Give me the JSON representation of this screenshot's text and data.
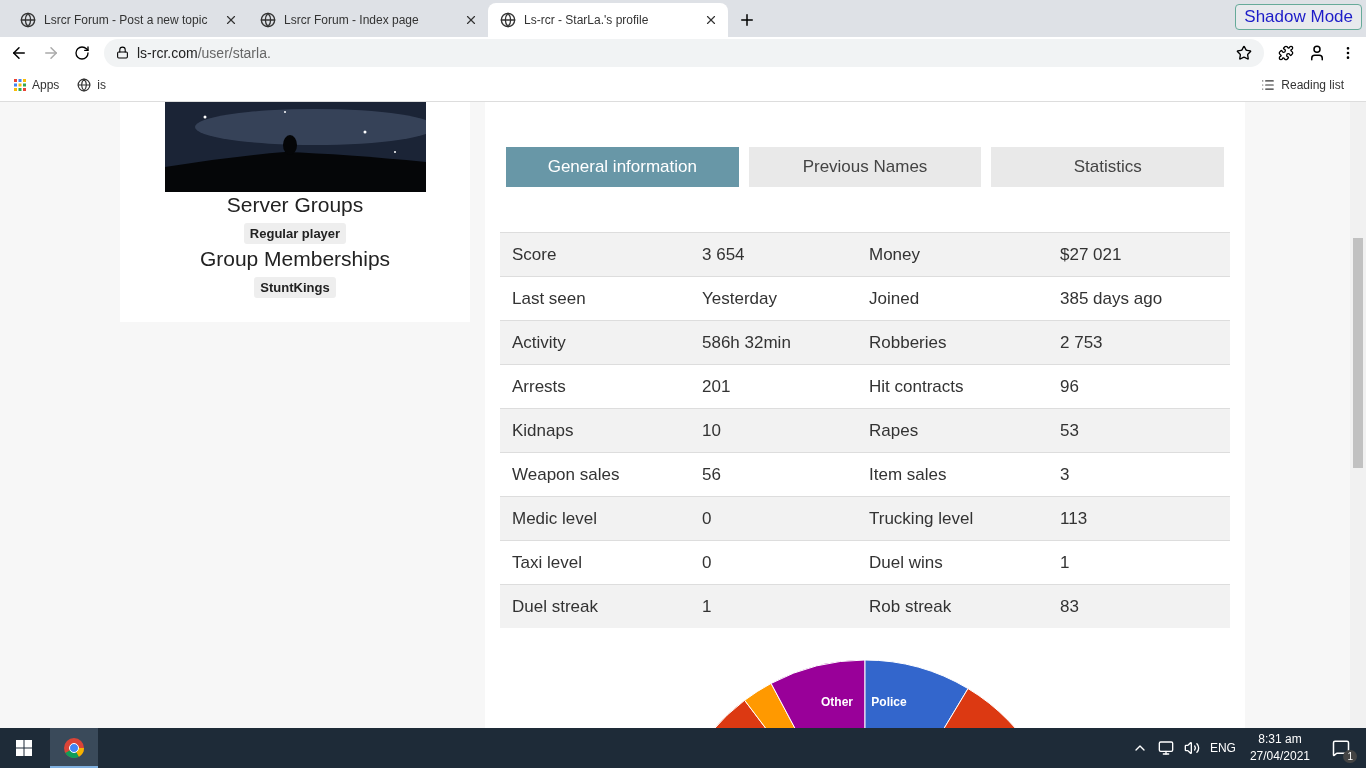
{
  "browser": {
    "tabs": [
      {
        "title": "Lsrcr Forum - Post a new topic",
        "selected": false
      },
      {
        "title": "Lsrcr Forum - Index page",
        "selected": false
      },
      {
        "title": "Ls-rcr - StarLa.'s profile",
        "selected": true
      }
    ],
    "extension_button": "Shadow Mode",
    "url_host": "ls-rcr.com",
    "url_path": "/user/starla.",
    "bookmarks": [
      "Apps",
      "is"
    ],
    "reading_list": "Reading list"
  },
  "profile": {
    "server_groups_title": "Server Groups",
    "server_groups": [
      "Regular player"
    ],
    "memberships_title": "Group Memberships",
    "memberships": [
      "StuntKings"
    ]
  },
  "tabs": [
    {
      "label": "General information",
      "selected": true
    },
    {
      "label": "Previous Names",
      "selected": false
    },
    {
      "label": "Statistics",
      "selected": false
    }
  ],
  "stats": [
    [
      "Score",
      "3 654",
      "Money",
      "$27 021"
    ],
    [
      "Last seen",
      "Yesterday",
      "Joined",
      "385 days ago"
    ],
    [
      "Activity",
      "586h 32min",
      "Robberies",
      "2 753"
    ],
    [
      "Arrests",
      "201",
      "Hit contracts",
      "96"
    ],
    [
      "Kidnaps",
      "10",
      "Rapes",
      "53"
    ],
    [
      "Weapon sales",
      "56",
      "Item sales",
      "3"
    ],
    [
      "Medic level",
      "0",
      "Trucking level",
      "113"
    ],
    [
      "Taxi level",
      "0",
      "Duel wins",
      "1"
    ],
    [
      "Duel streak",
      "1",
      "Rob streak",
      "83"
    ]
  ],
  "pie": {
    "slices": [
      {
        "label": "Other",
        "color": "#990099"
      },
      {
        "label": "Police",
        "color": "#3366cc"
      }
    ]
  },
  "taskbar": {
    "language": "ENG",
    "time": "8:31 am",
    "date": "27/04/2021",
    "notifications": "1"
  }
}
